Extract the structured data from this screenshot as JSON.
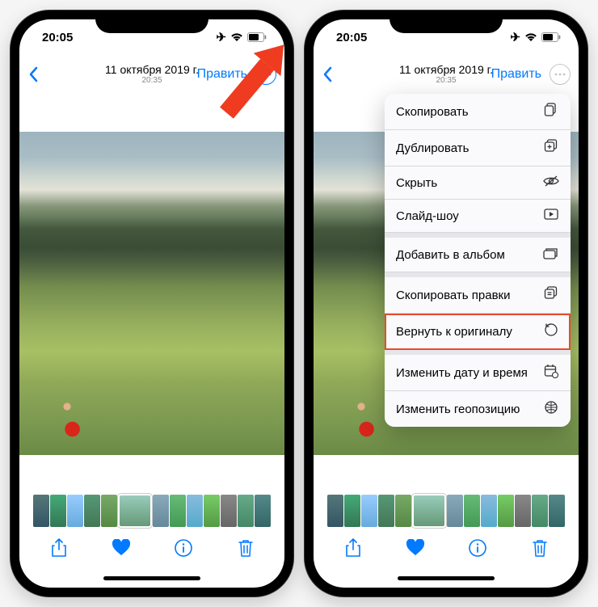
{
  "status": {
    "time": "20:05"
  },
  "nav": {
    "date": "11 октября 2019 г.",
    "time": "20:35",
    "edit": "Править"
  },
  "menu": {
    "copy": "Скопировать",
    "duplicate": "Дублировать",
    "hide": "Скрыть",
    "slideshow": "Слайд-шоу",
    "add_to_album": "Добавить в альбом",
    "copy_edits": "Скопировать правки",
    "revert": "Вернуть к оригиналу",
    "change_date": "Изменить дату и время",
    "change_location": "Изменить геопозицию"
  }
}
